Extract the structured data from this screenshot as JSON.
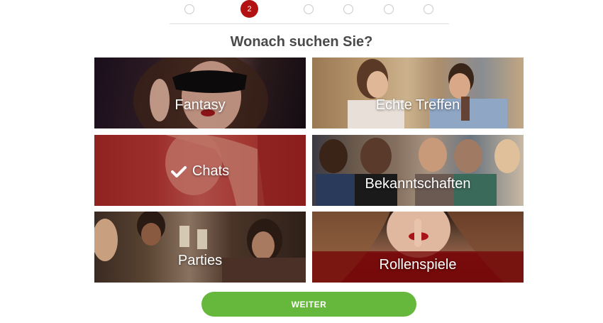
{
  "steps": {
    "current_label": "2"
  },
  "question": "Wonach suchen Sie?",
  "tiles": [
    {
      "label": "Fantasy",
      "selected": false,
      "image": "masked-woman-photo"
    },
    {
      "label": "Echte Treffen",
      "selected": false,
      "image": "couple-cafe-photo"
    },
    {
      "label": "Chats",
      "selected": true,
      "image": "woman-smiling-photo"
    },
    {
      "label": "Bekanntschaften",
      "selected": false,
      "image": "group-friends-photo"
    },
    {
      "label": "Parties",
      "selected": false,
      "image": "party-toast-photo"
    },
    {
      "label": "Rollenspiele",
      "selected": false,
      "image": "woman-finger-lips-photo"
    }
  ],
  "next_button": "WEITER",
  "colors": {
    "active_step": "#b31212",
    "button": "#66b83c",
    "selected_overlay": "#961e1e"
  }
}
